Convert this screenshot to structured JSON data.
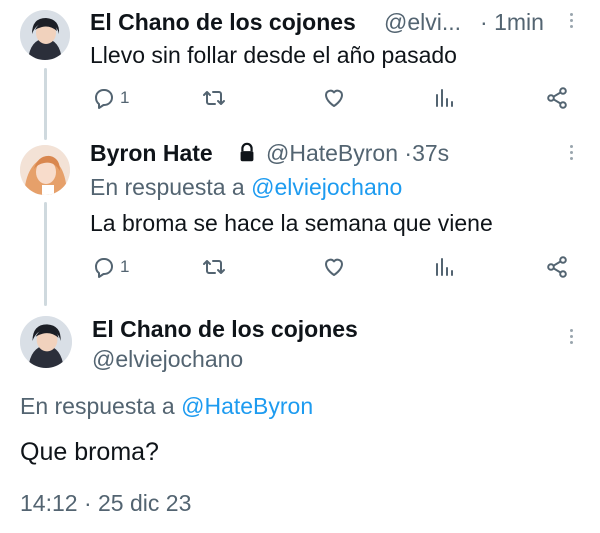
{
  "tweets": [
    {
      "author_name": "El Chano de los cojones",
      "handle": "@elvi...",
      "separator": "·",
      "time": "1min",
      "text": "Llevo sin follar desde el año pasado",
      "reply_count": "1"
    },
    {
      "author_name": "Byron Hate",
      "handle": "@HateByron",
      "separator": "·",
      "time": "37s",
      "reply_prefix": "En respuesta a",
      "reply_mention": "@elviejochano",
      "text": "La broma se hace la semana que viene",
      "reply_count": "1"
    }
  ],
  "main_tweet": {
    "author_name": "El Chano de los cojones",
    "handle": "@elviejochano",
    "reply_prefix": "En respuesta a",
    "reply_mention": "@HateByron",
    "text": "Que broma?",
    "time": "14:12",
    "separator": "·",
    "date": "25 dic 23"
  },
  "icons": {
    "reply": "reply-icon",
    "retweet": "retweet-icon",
    "like": "heart-icon",
    "views": "views-icon",
    "share": "share-icon",
    "lock": "lock-icon",
    "more": "more-icon"
  },
  "colors": {
    "link": "#1d9bf0",
    "secondary": "#536471",
    "thread_line": "#cfd9de"
  }
}
